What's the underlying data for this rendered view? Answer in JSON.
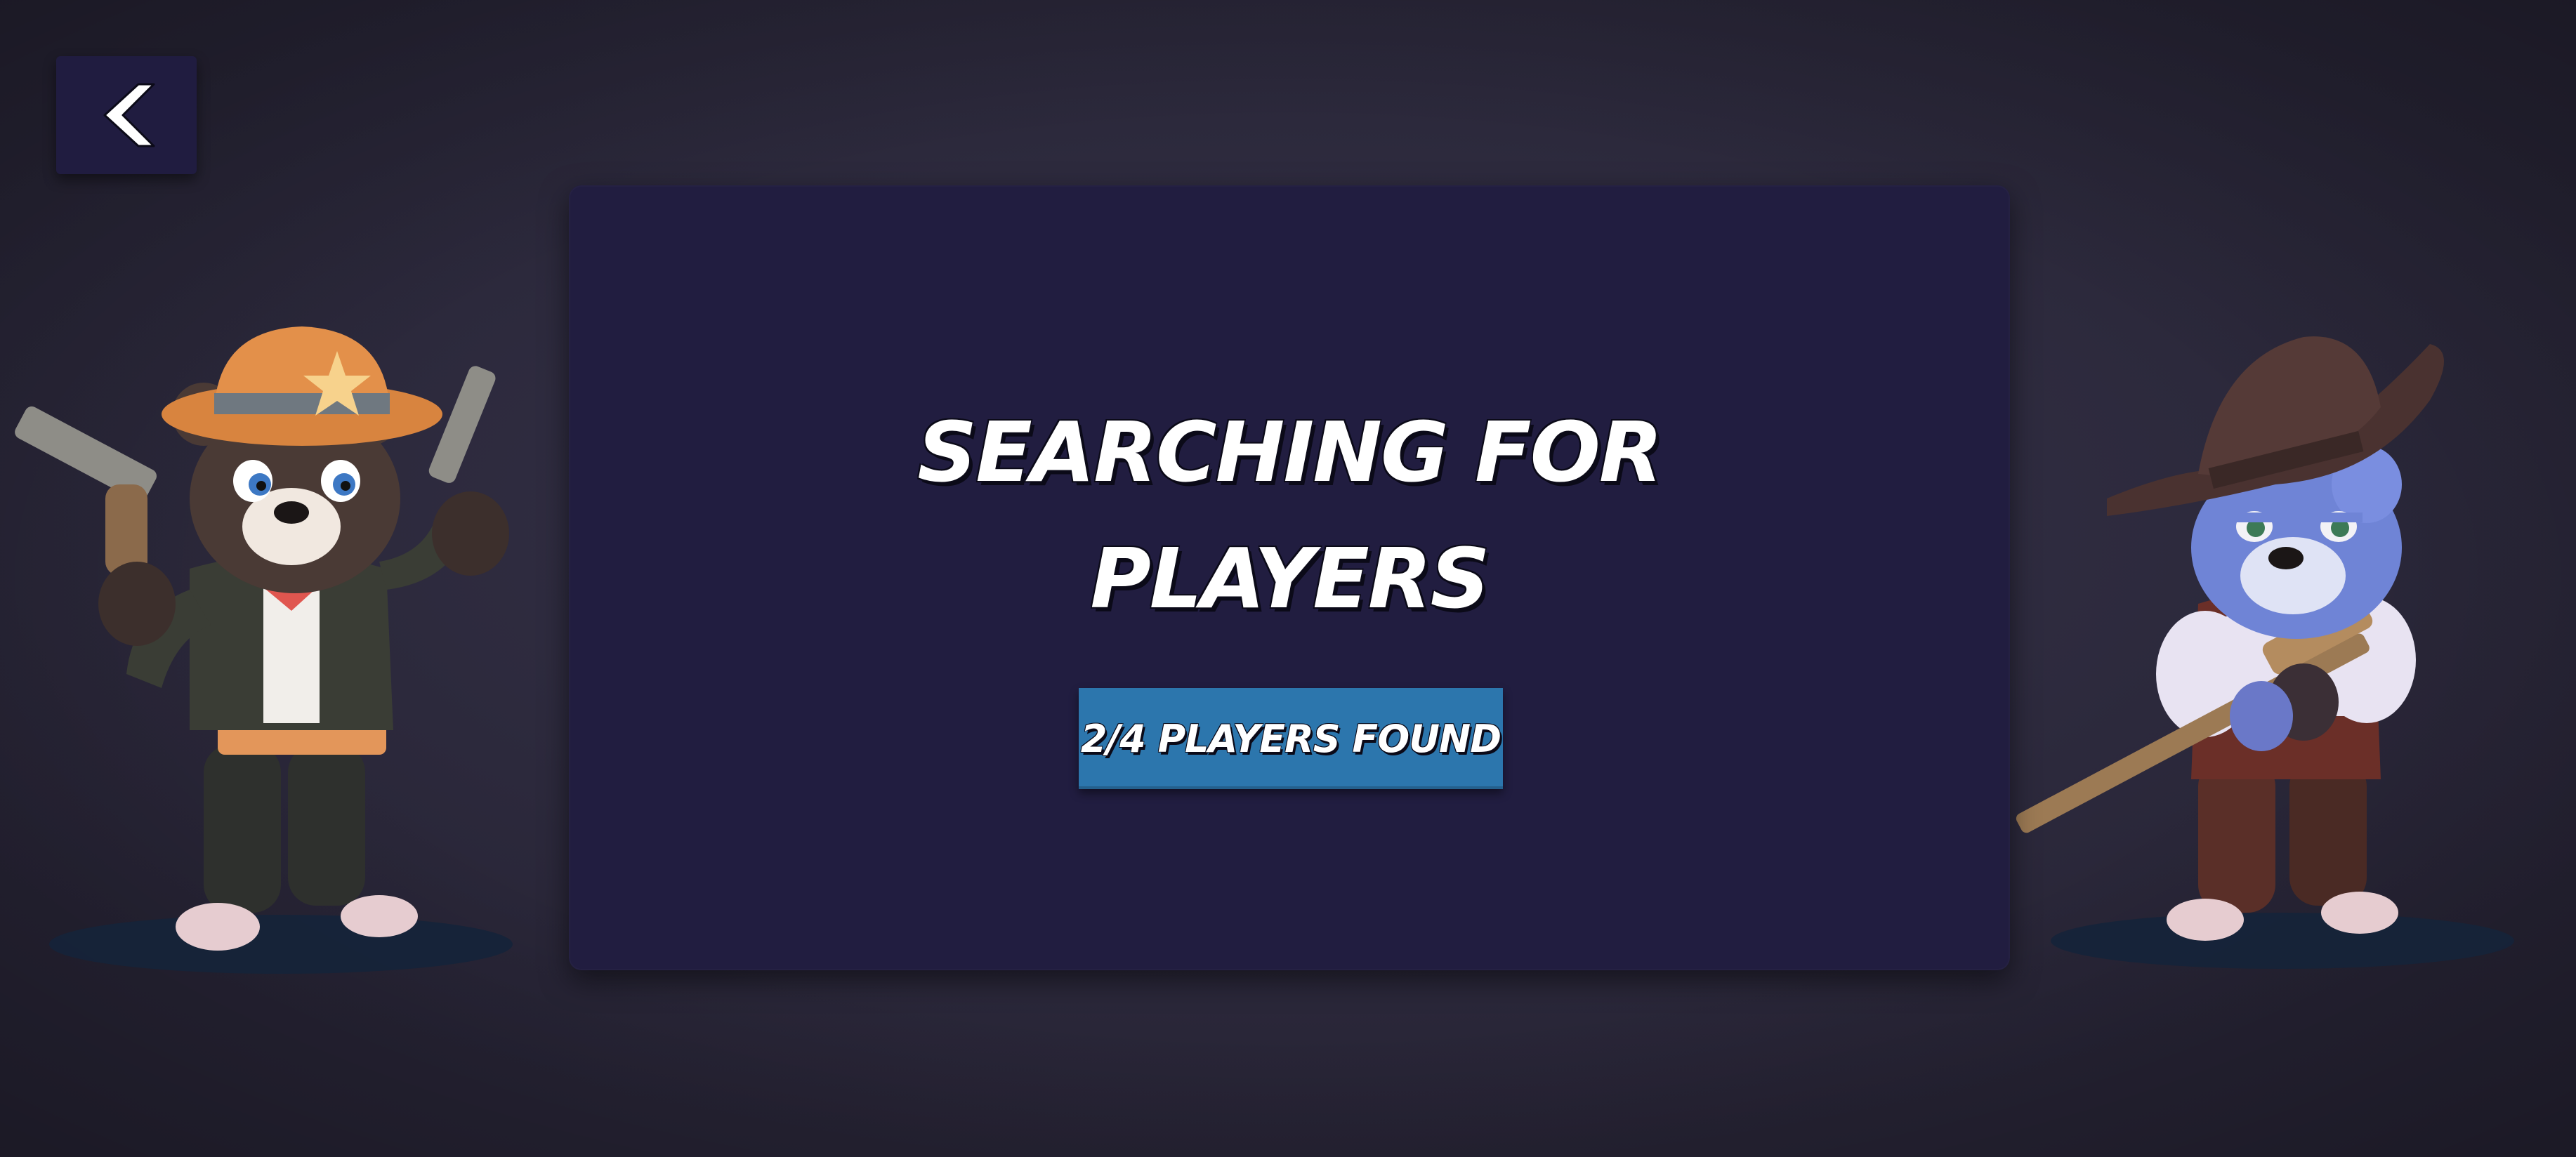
{
  "screen": {
    "title_line1": "SEARCHING FOR",
    "title_line2": "PLAYERS",
    "status": "2/4 PLAYERS FOUND"
  },
  "players_found": 2,
  "players_needed": 4,
  "icons": {
    "back": "chevron-left-icon"
  },
  "characters": {
    "left": "cowboy-bear-dual-revolvers",
    "right": "blue-bear-outlaw-with-rifle"
  },
  "colors": {
    "background": "#2f2c40",
    "panel": "#211d40",
    "back_button": "#201c40",
    "badge": "#2c76ad",
    "text": "#ffffff",
    "text_outline": "#0b0a18"
  }
}
